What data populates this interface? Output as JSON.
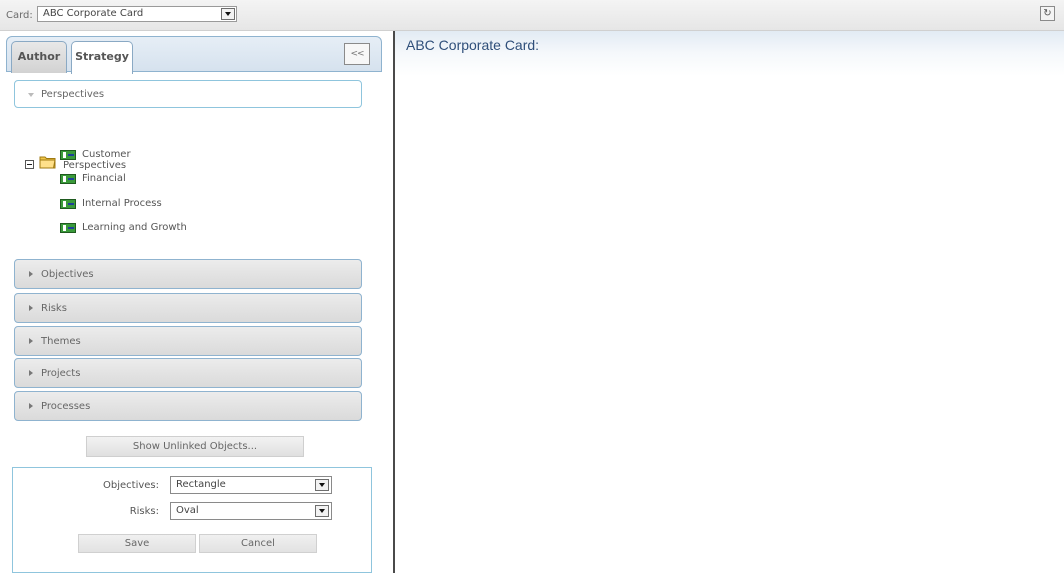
{
  "topbar": {
    "card_label": "Card:",
    "card_value": "ABC Corporate Card",
    "refresh_icon": "refresh-icon"
  },
  "tabs": [
    {
      "label": "Author",
      "active": false
    },
    {
      "label": "Strategy",
      "active": true
    }
  ],
  "collapse_button_label": "<<",
  "perspectives_section": {
    "header": "Perspectives",
    "root_label": "Perspectives",
    "items": [
      "Customer",
      "Financial",
      "Internal Process",
      "Learning and Growth"
    ]
  },
  "sections": [
    "Objectives",
    "Risks",
    "Themes",
    "Projects",
    "Processes"
  ],
  "show_unlinked_label": "Show Unlinked Objects...",
  "settings": {
    "objectives_label": "Objectives:",
    "objectives_value": "Rectangle",
    "risks_label": "Risks:",
    "risks_value": "Oval",
    "save_label": "Save",
    "cancel_label": "Cancel"
  },
  "map": {
    "title": "ABC Corporate Card:"
  },
  "colors": {
    "accent_border": "#8fb3cf",
    "title_text": "#2f4f7a",
    "node_icon": "#3a9a3a"
  }
}
